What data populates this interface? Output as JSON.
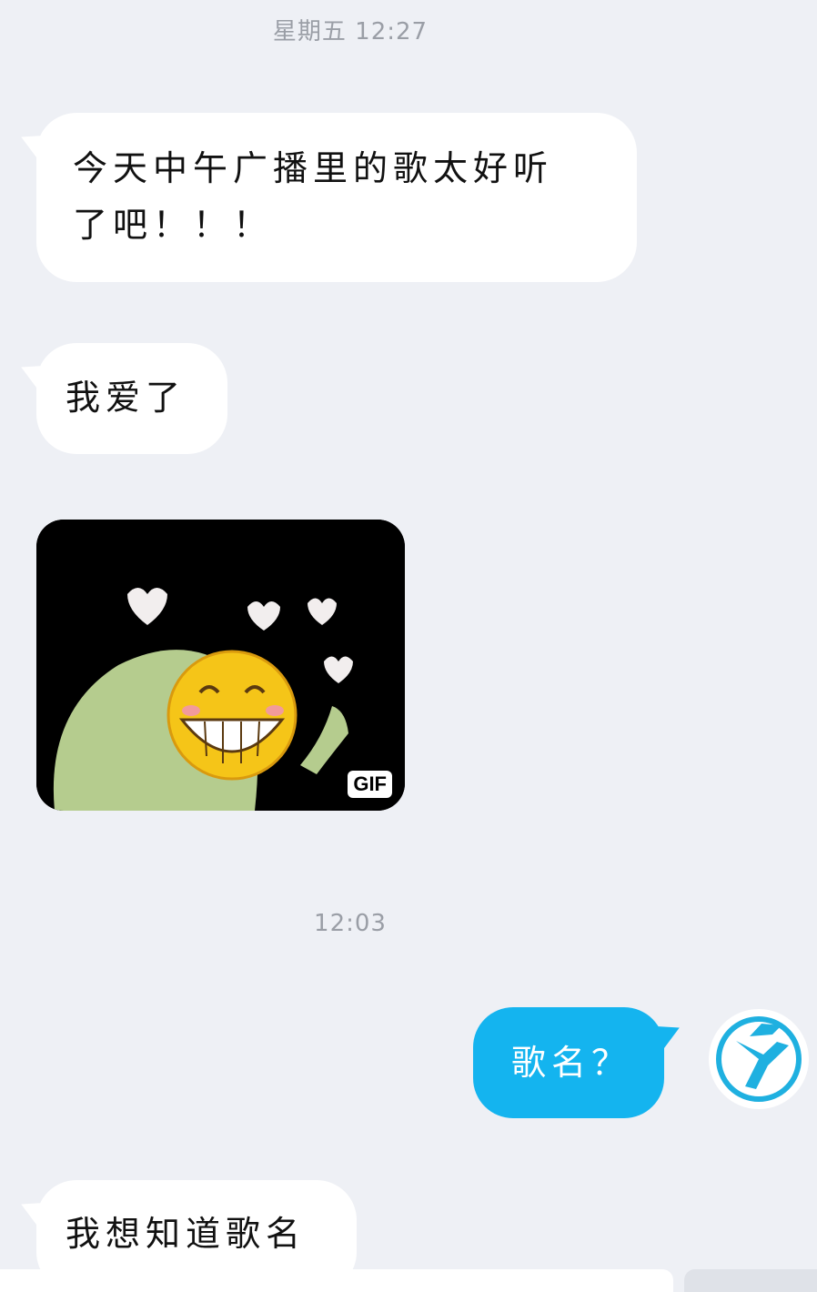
{
  "chat": {
    "timestamp_top": "星期五 12:27",
    "timestamp_mid": "12:03",
    "messages": [
      {
        "sender": "other",
        "line1": "今天中午广播里的歌太好听",
        "line2": "了吧！！！"
      },
      {
        "sender": "other",
        "text": "我爱了"
      },
      {
        "sender": "other",
        "type": "sticker",
        "badge": "GIF",
        "icon": "laughing-face-sticker"
      },
      {
        "sender": "me",
        "text": "歌名？"
      },
      {
        "sender": "other",
        "text": "我想知道歌名"
      }
    ]
  },
  "colors": {
    "background": "#eef0f5",
    "incoming_bubble": "#ffffff",
    "outgoing_bubble": "#14b4ef",
    "timestamp": "#9a9ea6"
  },
  "avatar": {
    "icon": "blue-logo-avatar-icon"
  }
}
